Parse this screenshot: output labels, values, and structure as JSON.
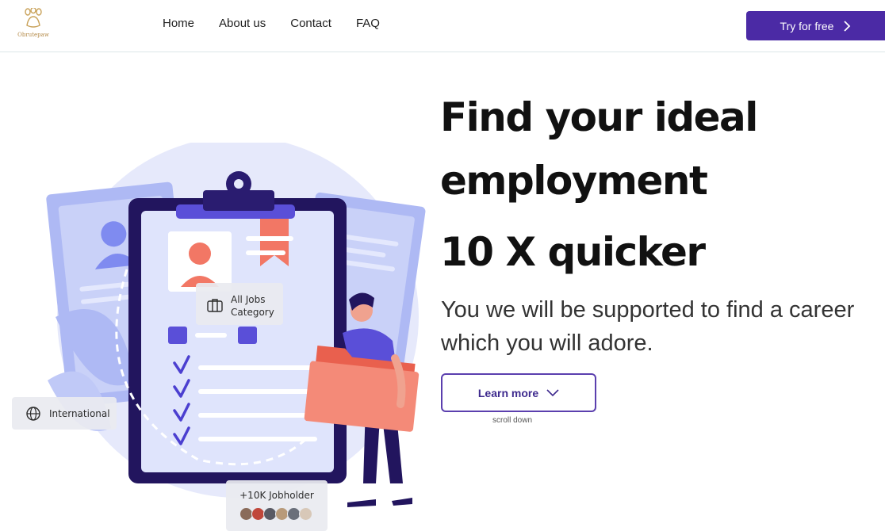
{
  "header": {
    "logo_text": "Obrutepaw",
    "nav": [
      {
        "label": "Home"
      },
      {
        "label": "About us"
      },
      {
        "label": "Contact"
      },
      {
        "label": "FAQ"
      }
    ],
    "cta_label": "Try for free"
  },
  "hero": {
    "title_line1": "Find your ideal",
    "title_line2": "employment",
    "title_line3": "10 X quicker",
    "subtitle": "You we will be supported to find a career which you will adore.",
    "learn_more_label": "Learn more",
    "scroll_hint": "scroll down"
  },
  "illustration": {
    "tag_jobs": "All Jobs Category",
    "tag_international": "International",
    "tag_jobholders": "+10K Jobholder",
    "avatar_colors": [
      "#8a6b5a",
      "#c0473b",
      "#5a5a64",
      "#b89a7a",
      "#6a6f7a",
      "#d8c8b8"
    ]
  },
  "colors": {
    "accent": "#4b2aa5",
    "illustration_blue": "#7f8bf0",
    "illustration_coral": "#f27765",
    "illustration_navy": "#22155e"
  }
}
